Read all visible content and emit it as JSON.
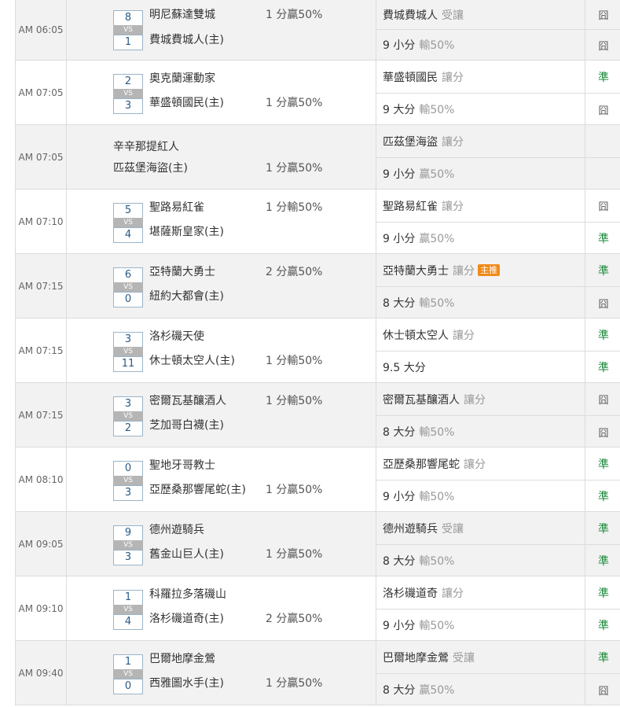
{
  "rows": [
    {
      "time": "AM 06:05",
      "s1": "8",
      "s2": "1",
      "vs": "VS",
      "away": "明尼蘇達雙城",
      "home": "費城費城人(主)",
      "odd": "1 分贏50%",
      "odd_on": "away",
      "p1": "費城費城人",
      "n1": "受讓",
      "r1": "囧",
      "p2": "9 小分",
      "n2": "輸50%",
      "r2": "囧"
    },
    {
      "time": "AM 07:05",
      "s1": "2",
      "s2": "3",
      "vs": "VS",
      "away": "奧克蘭運動家",
      "home": "華盛頓國民(主)",
      "odd": "1 分贏50%",
      "odd_on": "home",
      "p1": "華盛頓國民",
      "n1": "讓分",
      "r1": "準",
      "p2": "9 大分",
      "n2": "輸50%",
      "r2": "囧"
    },
    {
      "time": "AM 07:05",
      "s1": "",
      "s2": "",
      "vs": "",
      "away": "辛辛那提紅人",
      "home": "匹茲堡海盜(主)",
      "odd": "1 分贏50%",
      "odd_on": "home",
      "p1": "匹茲堡海盜",
      "n1": "讓分",
      "r1": "",
      "p2": "9 小分",
      "n2": "贏50%",
      "r2": ""
    },
    {
      "time": "AM 07:10",
      "s1": "5",
      "s2": "4",
      "vs": "VS",
      "away": "聖路易紅雀",
      "home": "堪薩斯皇家(主)",
      "odd": "1 分輸50%",
      "odd_on": "away",
      "p1": "聖路易紅雀",
      "n1": "讓分",
      "r1": "囧",
      "p2": "9 小分",
      "n2": "贏50%",
      "r2": "準"
    },
    {
      "time": "AM 07:15",
      "s1": "6",
      "s2": "0",
      "vs": "VS",
      "away": "亞特蘭大勇士",
      "home": "紐約大都會(主)",
      "odd": "2 分贏50%",
      "odd_on": "away",
      "p1": "亞特蘭大勇士",
      "n1": "讓分",
      "badge": "主推",
      "r1": "準",
      "p2": "8 大分",
      "n2": "輸50%",
      "r2": "囧"
    },
    {
      "time": "AM 07:15",
      "s1": "3",
      "s2": "11",
      "vs": "VS",
      "away": "洛杉磯天使",
      "home": "休士頓太空人(主)",
      "odd": "1 分輸50%",
      "odd_on": "home",
      "p1": "休士頓太空人",
      "n1": "讓分",
      "r1": "準",
      "p2": "9.5 大分",
      "n2": "",
      "r2": "準"
    },
    {
      "time": "AM 07:15",
      "s1": "3",
      "s2": "2",
      "vs": "VS",
      "away": "密爾瓦基釀酒人",
      "home": "芝加哥白襪(主)",
      "odd": "1 分輸50%",
      "odd_on": "away",
      "p1": "密爾瓦基釀酒人",
      "n1": "讓分",
      "r1": "囧",
      "p2": "8 大分",
      "n2": "輸50%",
      "r2": "囧"
    },
    {
      "time": "AM 08:10",
      "s1": "0",
      "s2": "3",
      "vs": "VS",
      "away": "聖地牙哥教士",
      "home": "亞歷桑那響尾蛇(主)",
      "odd": "1 分贏50%",
      "odd_on": "home",
      "p1": "亞歷桑那響尾蛇",
      "n1": "讓分",
      "r1": "準",
      "p2": "9 小分",
      "n2": "輸50%",
      "r2": "準"
    },
    {
      "time": "AM 09:05",
      "s1": "9",
      "s2": "3",
      "vs": "VS",
      "away": "德州遊騎兵",
      "home": "舊金山巨人(主)",
      "odd": "1 分贏50%",
      "odd_on": "home",
      "p1": "德州遊騎兵",
      "n1": "受讓",
      "r1": "準",
      "p2": "8 大分",
      "n2": "輸50%",
      "r2": "準"
    },
    {
      "time": "AM 09:10",
      "s1": "1",
      "s2": "4",
      "vs": "VS",
      "away": "科羅拉多落磯山",
      "home": "洛杉磯道奇(主)",
      "odd": "2 分贏50%",
      "odd_on": "home",
      "p1": "洛杉磯道奇",
      "n1": "讓分",
      "r1": "準",
      "p2": "9 小分",
      "n2": "輸50%",
      "r2": "準"
    },
    {
      "time": "AM 09:40",
      "s1": "1",
      "s2": "0",
      "vs": "VS",
      "away": "巴爾地摩金鶯",
      "home": "西雅圖水手(主)",
      "odd": "1 分贏50%",
      "odd_on": "home",
      "p1": "巴爾地摩金鶯",
      "n1": "受讓",
      "r1": "準",
      "p2": "8 大分",
      "n2": "贏50%",
      "r2": "囧"
    }
  ]
}
